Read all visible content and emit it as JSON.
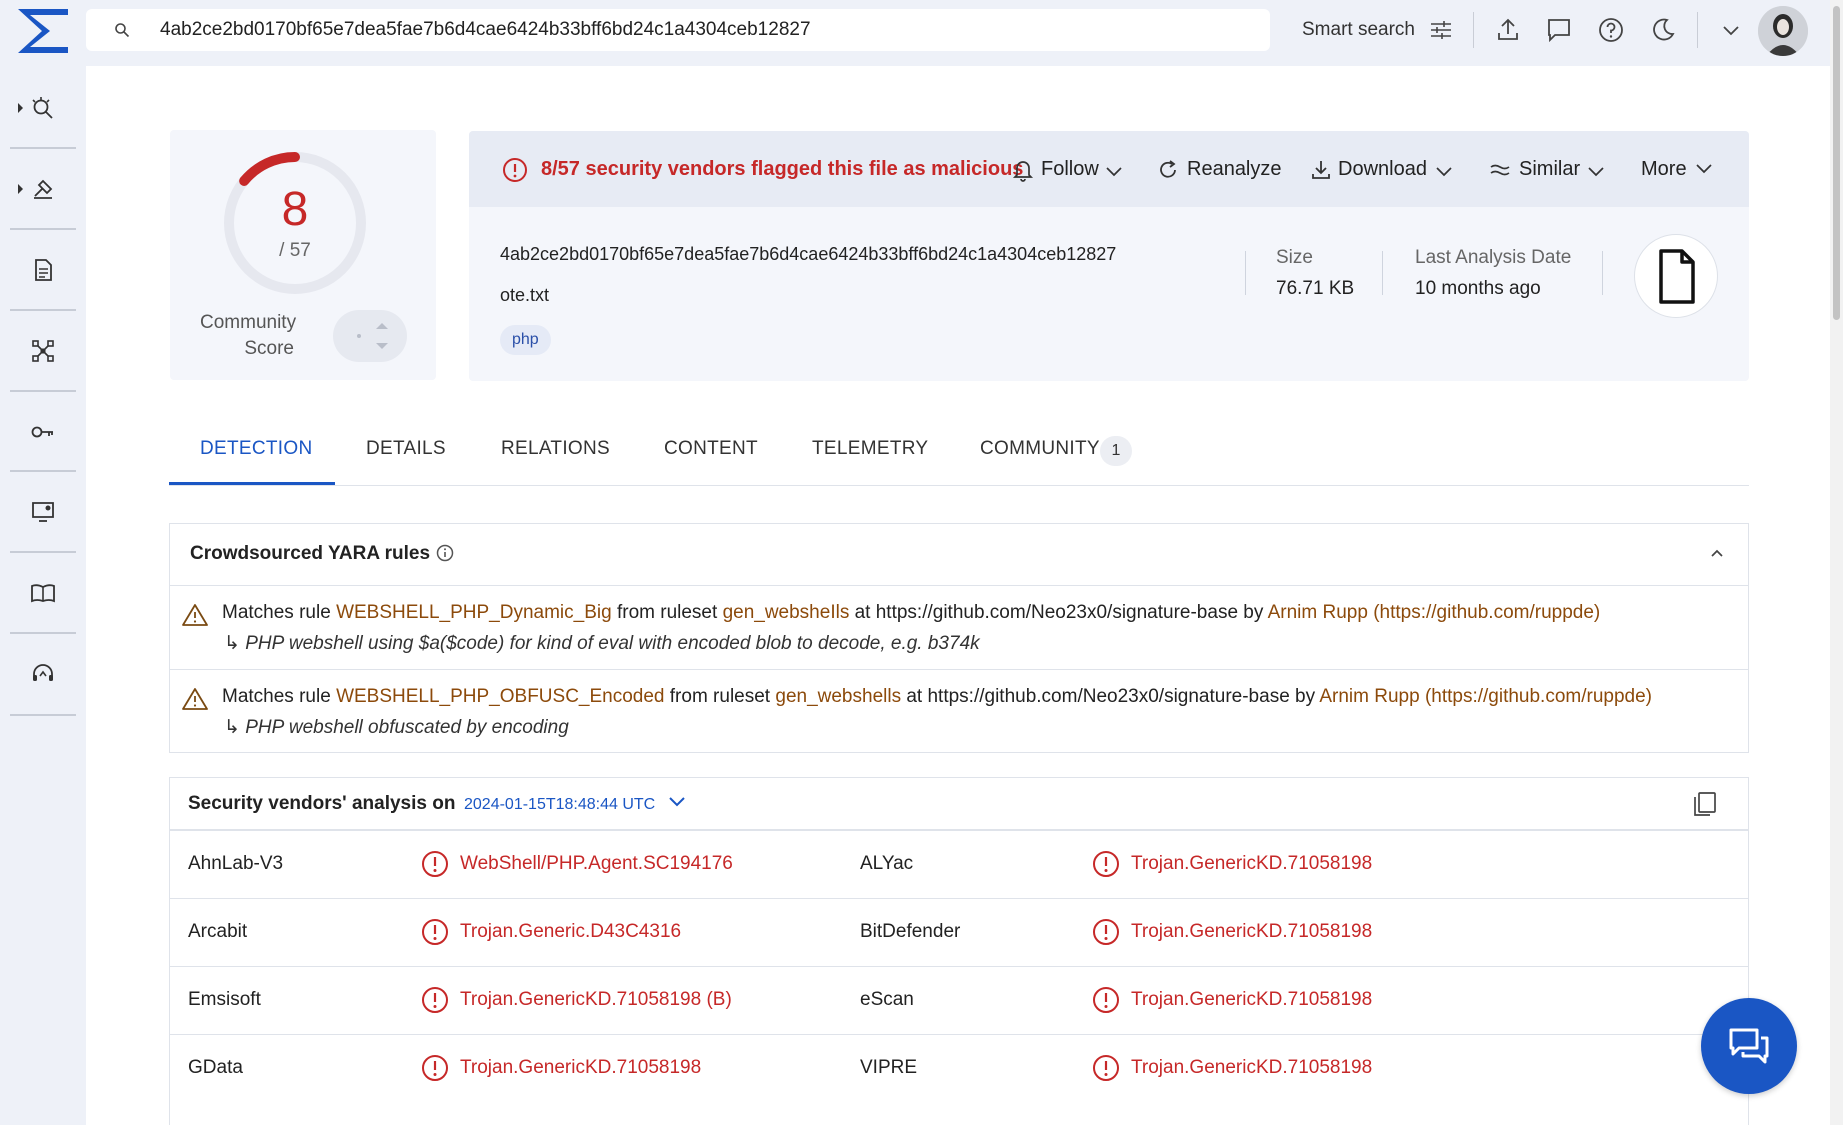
{
  "search": {
    "value": "4ab2ce2bd0170bf65e7dea5fae7b6d4cae6424b33bff6bd24c1a4304ceb12827",
    "smart_label": "Smart search"
  },
  "score": {
    "value": "8",
    "total": "/ 57",
    "fraction": 0.14,
    "community_label_1": "Community",
    "community_label_2": "Score"
  },
  "header": {
    "flag_text": "8/57 security vendors flagged this file as malicious",
    "follow": "Follow",
    "reanalyze": "Reanalyze",
    "download": "Download",
    "similar": "Similar",
    "more": "More",
    "hash": "4ab2ce2bd0170bf65e7dea5fae7b6d4cae6424b33bff6bd24c1a4304ceb12827",
    "filename": "ote.txt",
    "tag": "php",
    "size_label": "Size",
    "size_value": "76.71 KB",
    "date_label": "Last Analysis Date",
    "date_value": "10 months ago"
  },
  "tabs": [
    {
      "label": "DETECTION"
    },
    {
      "label": "DETAILS"
    },
    {
      "label": "RELATIONS"
    },
    {
      "label": "CONTENT"
    },
    {
      "label": "TELEMETRY"
    },
    {
      "label": "COMMUNITY",
      "badge": "1"
    }
  ],
  "yara": {
    "title": "Crowdsourced YARA rules",
    "rules": [
      {
        "prefix": "Matches rule",
        "rule": "WEBSHELL_PHP_Dynamic_Big",
        "mid": "from ruleset",
        "ruleset": "gen_websheIls",
        "at": "at https://github.com/Neo23x0/signature-base by",
        "author": "Arnim Rupp (https://github.com/ruppde)",
        "desc": "PHP webshell using $a($code) for kind of eval with encoded blob to decode, e.g. b374k"
      },
      {
        "prefix": "Matches rule",
        "rule": "WEBSHELL_PHP_OBFUSC_Encoded",
        "mid": "from ruleset",
        "ruleset": "gen_webshells",
        "at": "at https://github.com/Neo23x0/signature-base by",
        "author": "Arnim Rupp (https://github.com/ruppde)",
        "desc": "PHP webshell obfuscated by encoding"
      }
    ]
  },
  "vendors": {
    "title": "Security vendors' analysis on",
    "date": "2024-01-15T18:48:44 UTC",
    "rows": [
      {
        "v1": "AhnLab-V3",
        "r1": "WebShell/PHP.Agent.SC194176",
        "v2": "ALYac",
        "r2": "Trojan.GenericKD.71058198"
      },
      {
        "v1": "Arcabit",
        "r1": "Trojan.Generic.D43C4316",
        "v2": "BitDefender",
        "r2": "Trojan.GenericKD.71058198"
      },
      {
        "v1": "Emsisoft",
        "r1": "Trojan.GenericKD.71058198 (B)",
        "v2": "eScan",
        "r2": "Trojan.GenericKD.71058198"
      },
      {
        "v1": "GData",
        "r1": "Trojan.GenericKD.71058198",
        "v2": "VIPRE",
        "r2": "Trojan.GenericKD.71058198"
      }
    ]
  },
  "colors": {
    "malicious": "#c62828",
    "accent": "#1a56c4",
    "link": "#8c4a0b"
  }
}
